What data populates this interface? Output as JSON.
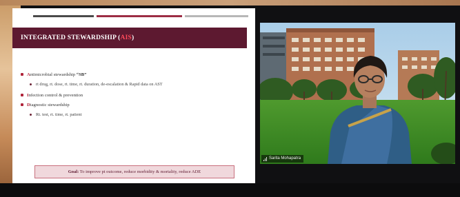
{
  "slide": {
    "title_main": "INTEGRATED STEWARDSHIP (",
    "title_acronym": "AIS",
    "title_close": ")",
    "bullets": [
      {
        "first": "A",
        "rest": "ntimicrobial stewardship ",
        "emph": "“SB”"
      },
      {
        "text": "rt drug, rt. dose, rt. time, rt. duration, de-escalation & Rapid data on AST"
      },
      {
        "first": "I",
        "rest": "nfection control & prevention"
      },
      {
        "first": "D",
        "rest": "iagnostic stewardship"
      },
      {
        "text": "Rt. test, rt. time, rt. patient"
      }
    ],
    "goal_label": "Goal:",
    "goal_text": " To improve pt outcome, reduce morbidity & mortality, reduce ADE"
  },
  "video": {
    "participant_name": "Sarita Mohapatra"
  },
  "colors": {
    "title_bar": "#5d1930",
    "accent_red": "#b0243a",
    "goal_bg": "#f0d8dc"
  }
}
